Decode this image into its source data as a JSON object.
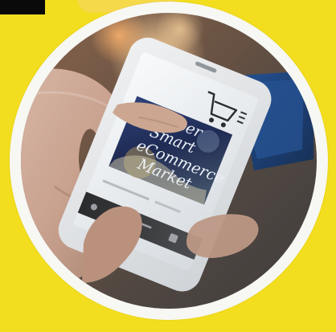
{
  "image": {
    "subject": "hand holding smartphone with shopping cart app",
    "background_color": "#f2dd1f",
    "ring_color": "#f7f7f3",
    "accent_block_color": "#0a0a0a"
  },
  "phone_screen": {
    "cart_icon": "shopping-cart-icon",
    "menu_icon": "hamburger-menu-icon",
    "headline_lines": [
      "Super",
      "Smart",
      "eCommerce",
      "Market"
    ]
  }
}
